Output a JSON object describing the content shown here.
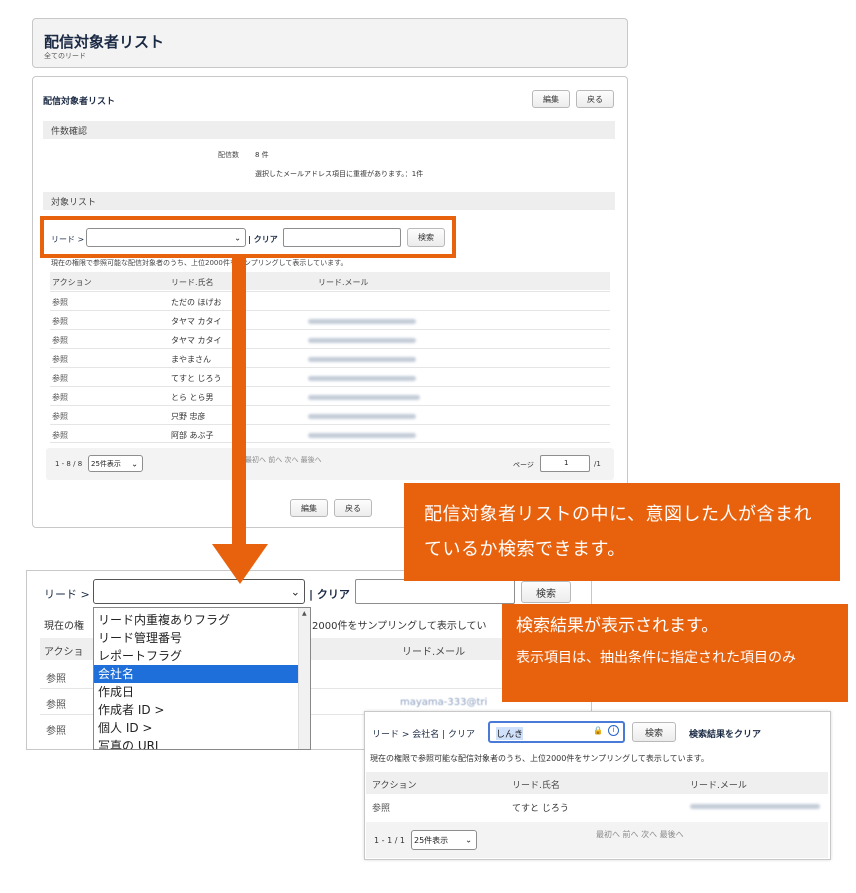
{
  "page": {
    "title": "配信対象者リスト",
    "subtitle": "全てのリード"
  },
  "main": {
    "section_title": "配信対象者リスト",
    "buttons": {
      "edit": "編集",
      "back": "戻る"
    },
    "count_section": "件数確認",
    "count_label": "配信数",
    "count_value": "8 件",
    "duplicate_note": "選択したメールアドレス項目に重複があります。：1件",
    "target_section": "対象リスト",
    "filter": {
      "field_label": "リード >",
      "clear": "| クリア",
      "search": "検索",
      "field_value": "",
      "query_value": ""
    },
    "sampling_note": "現在の権限で参照可能な配信対象者のうち、上位2000件をサンプリングして表示しています。",
    "table": {
      "headers": [
        "アクション",
        "リード.氏名",
        "リード.メール"
      ],
      "rows": [
        {
          "action": "参照",
          "name": "ただの ほげお"
        },
        {
          "action": "参照",
          "name": "タヤマ カタイ"
        },
        {
          "action": "参照",
          "name": "タヤマ カタイ"
        },
        {
          "action": "参照",
          "name": "まやまさん"
        },
        {
          "action": "参照",
          "name": "てすと じろう"
        },
        {
          "action": "参照",
          "name": "とら とら男"
        },
        {
          "action": "参照",
          "name": "只野 忠彦"
        },
        {
          "action": "参照",
          "name": "阿部 あぶ子"
        }
      ]
    },
    "pager": {
      "range": "1 - 8 / 8",
      "per_page": "25件表示",
      "nav": "最初へ 前へ 次へ 最後へ",
      "page_label": "ページ",
      "page_value": "1",
      "page_total": "/1"
    }
  },
  "callouts": {
    "first": "配信対象者リストの中に、意図した人が含まれているか検索できます。",
    "second_title": "検索結果が表示されます。",
    "second_body": "表示項目は、抽出条件に指定された項目のみ"
  },
  "zoom": {
    "field_label": "リード >",
    "clear": "| クリア",
    "search": "検索",
    "note_visible": "現在の権",
    "note_tail": "2000件をサンプリングして表示してい",
    "headers": [
      "アクショ",
      "リード.メール"
    ],
    "rows": [
      "参照",
      "参照",
      "参照"
    ],
    "email_partial": "mayama-333@tri",
    "dropdown_options": [
      "リード内重複ありフラグ",
      "リード管理番号",
      "レポートフラグ",
      "会社名",
      "作成日",
      "作成者 ID >",
      "個人 ID >",
      "写真の URL"
    ],
    "selected_option": "会社名"
  },
  "result": {
    "field_label": "リード > 会社名 | クリア",
    "query_value": "しんき",
    "search": "検索",
    "clear_results": "検索結果をクリア",
    "note": "現在の権限で参照可能な配信対象者のうち、上位2000件をサンプリングして表示しています。",
    "headers": [
      "アクション",
      "リード.氏名",
      "リード.メール"
    ],
    "row": {
      "action": "参照",
      "name": "てすと じろう"
    },
    "pager_range": "1 - 1 / 1",
    "per_page": "25件表示",
    "nav": "最初へ 前へ 次へ 最後へ"
  },
  "colors": {
    "accent": "#e8620e",
    "selection": "#1e6fd9"
  }
}
